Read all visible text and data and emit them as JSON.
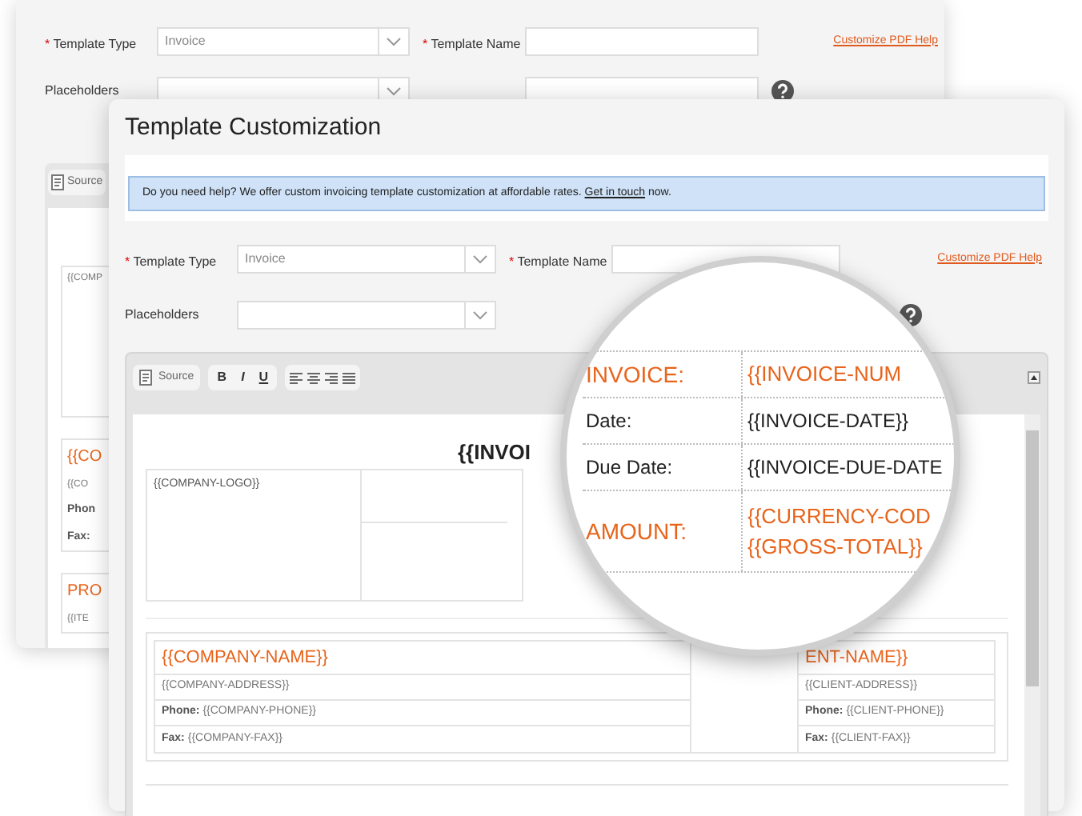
{
  "back_window": {
    "form": {
      "type_field": {
        "marker": "*",
        "label": "Template Type",
        "value": "Invoice"
      },
      "name_field": {
        "marker": "*",
        "label": "Template Name"
      },
      "help_link": "Customize PDF Help",
      "placeholders_label": "Placeholders"
    },
    "editor": {
      "source_button": "Source",
      "blocks": [
        {
          "lines": [
            {
              "kind": "plain",
              "text": "{{COMP"
            }
          ]
        },
        {
          "lines": [
            {
              "kind": "title",
              "text": "{{CO"
            },
            {
              "kind": "plain",
              "text": "{{CO"
            },
            {
              "kind": "bold",
              "text": "Phon"
            },
            {
              "kind": "bold",
              "text": "Fax:"
            }
          ]
        },
        {
          "lines": [
            {
              "kind": "title",
              "text": "PRO"
            },
            {
              "kind": "plain",
              "text": "{{ITE"
            }
          ]
        }
      ]
    }
  },
  "front_window": {
    "title": "Template Customization",
    "banner": {
      "text": "Do you need help? We offer custom invoicing template customization at affordable rates.",
      "link": "Get in touch",
      "after": "now."
    },
    "form": {
      "type_field": {
        "marker": "*",
        "label": "Template Type",
        "value": "Invoice"
      },
      "name_field": {
        "marker": "*",
        "label": "Template Name"
      },
      "help_link": "Customize PDF Help",
      "placeholders_label": "Placeholders"
    },
    "toolbar": {
      "source_button": "Source",
      "format_buttons": [
        "B",
        "I",
        "U"
      ]
    },
    "document": {
      "heading": "{{INVOI",
      "logo": "{{COMPANY-LOGO}}",
      "company": {
        "name": "{{COMPANY-NAME}}",
        "address": "{{COMPANY-ADDRESS}}",
        "phone_label": "Phone:",
        "phone": "{{COMPANY-PHONE}}",
        "fax_label": "Fax:",
        "fax": "{{COMPANY-FAX}}"
      },
      "client": {
        "name": "ENT-NAME}}",
        "address": "{{CLIENT-ADDRESS}}",
        "phone_label": "Phone:",
        "phone": "{{CLIENT-PHONE}}",
        "fax_label": "Fax:",
        "fax": "{{CLIENT-FAX}}"
      }
    }
  },
  "magnifier": {
    "rows": [
      {
        "kind": "accent",
        "label": "INVOICE:",
        "values": [
          "{{INVOICE-NUM"
        ]
      },
      {
        "kind": "plain",
        "label": "Date:",
        "values": [
          "{{INVOICE-DATE}}"
        ]
      },
      {
        "kind": "plain",
        "label": "Due Date:",
        "values": [
          "{{INVOICE-DUE-DATE"
        ]
      },
      {
        "kind": "accent",
        "label": "AMOUNT:",
        "values": [
          "{{CURRENCY-COD",
          "{{GROSS-TOTAL}}"
        ]
      }
    ]
  }
}
